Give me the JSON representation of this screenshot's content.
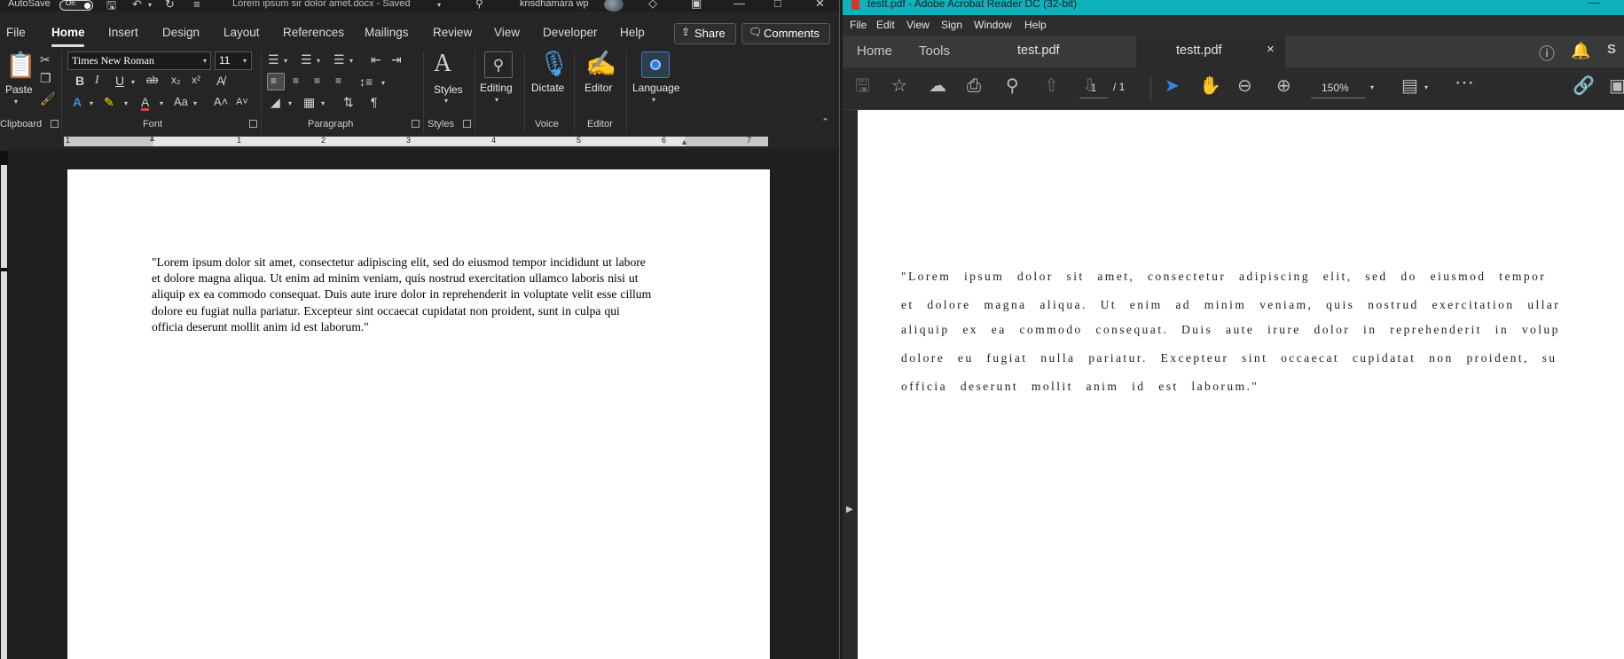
{
  "word": {
    "titlebar": {
      "autosave_label": "AutoSave",
      "autosave_state": "On",
      "document_title": "Lorem ipsum sir dolor amet.docx  -  Saved",
      "user_name": "krisdhamara wp"
    },
    "tabs": [
      "File",
      "Home",
      "Insert",
      "Design",
      "Layout",
      "References",
      "Mailings",
      "Review",
      "View",
      "Developer",
      "Help"
    ],
    "active_tab": "Home",
    "share_label": "Share",
    "comments_label": "Comments",
    "font_name": "Times New Roman",
    "font_size": "11",
    "labels": {
      "paste": "Paste",
      "styles": "Styles",
      "editing": "Editing",
      "dictate": "Dictate",
      "editor": "Editor",
      "language": "Language"
    },
    "groups": [
      "Clipboard",
      "Font",
      "Paragraph",
      "Styles",
      "Voice",
      "Editor"
    ],
    "ruler_numbers": [
      "1",
      "1",
      "2",
      "3",
      "4",
      "5",
      "6",
      "7"
    ],
    "body_lines": [
      "\"Lorem ipsum dolor sit amet, consectetur adipiscing elit, sed do eiusmod tempor incididunt ut labore",
      "et dolore magna aliqua. Ut enim ad minim veniam, quis nostrud exercitation ullamco laboris nisi ut",
      "aliquip ex ea commodo consequat. Duis aute irure dolor in reprehenderit in voluptate velit esse cillum",
      "dolore eu fugiat nulla pariatur. Excepteur sint occaecat cupidatat non proident, sunt in culpa qui",
      "officia deserunt mollit anim id est laborum.\""
    ]
  },
  "acrobat": {
    "window_title": "testt.pdf - Adobe Acrobat Reader DC (32-bit)",
    "menu": [
      "File",
      "Edit",
      "View",
      "Sign",
      "Window",
      "Help"
    ],
    "nav_tabs": [
      "Home",
      "Tools"
    ],
    "doc_tabs": [
      "test.pdf",
      "testt.pdf"
    ],
    "active_doc_tab": "testt.pdf",
    "page_current": "1",
    "page_total": "/ 1",
    "zoom": "150%",
    "body_lines": [
      "\"Lorem ipsum dolor sit amet, consectetur adipiscing elit, sed do eiusmod tempor",
      "et dolore magna aliqua. Ut enim ad minim veniam, quis nostrud exercitation ullar",
      "aliquip ex ea commodo consequat. Duis aute irure dolor in reprehenderit in volup",
      "dolore eu fugiat nulla pariatur. Excepteur sint occaecat cupidatat non proident, su",
      "officia deserunt mollit anim id est laborum.\""
    ],
    "colors": {
      "titlebar": "#0cb3bc",
      "accent_blue": "#2d8ceb"
    }
  }
}
